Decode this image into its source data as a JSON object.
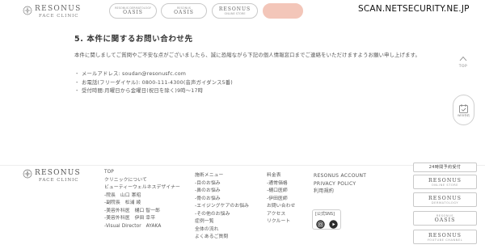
{
  "header": {
    "logo_main": "RESONUS",
    "logo_sub": "FACE CLINIC",
    "buttons": [
      {
        "title": "OASIS",
        "sub": "RESONUS DERMATOLOGY"
      },
      {
        "title": "OASIS",
        "sub": "RESONUS"
      },
      {
        "title": "RESONUS",
        "sub": "ONLINE STORE"
      },
      {
        "title": "",
        "sub": ""
      }
    ],
    "watermark": "SCAN.NETSECURITY.NE.JP"
  },
  "main": {
    "section_title": "5. 本件に関するお問い合わせ先",
    "body_text": "本件に関しましてご質問やご不安な点がございましたら、誠に恐縮ながら下記の個人情報窓口までご連絡をいただけますようお願い申し上げます。",
    "contact": [
      "メールアドレス: soudan@resonusfc.com",
      "お電話(フリーダイヤル): 0800-111-4300(音声ガイダンス5番)",
      "受付時間:月曜日から金曜日(祝日を除く)9時〜17時"
    ],
    "bullet": "・"
  },
  "side": {
    "to_top_label": "TOP",
    "reserve_label": "WEB予約"
  },
  "footer": {
    "logo_main": "RESONUS",
    "logo_sub": "FACE CLINIC",
    "col1": [
      "TOP",
      "クリニックについて",
      "ビューティーウェルネスデザイナー",
      "-院長　山口 憲昭",
      "-副院長　松浦 綾",
      "-美容外科医　樋口 智一郎",
      "-美容外科医　伊田 幸平",
      "-Visual Director　AYAKA"
    ],
    "col2": [
      "施術メニュー",
      "-目のお悩み",
      "-鼻のお悩み",
      "-骨のお悩み",
      "-エイジングケアのお悩み",
      "-その他のお悩み",
      "症例一覧",
      "全体の流れ",
      "よくあるご質問"
    ],
    "col3": [
      "料金表",
      "-通常価格",
      "-樋口医師",
      "-伊田医師",
      "お問い合わせ",
      "アクセス",
      "リクルート"
    ],
    "col4": [
      "RESONUS ACCOUNT",
      "PRIVACY POLICY",
      "利用規約"
    ],
    "sns_label": "[公式SNS]",
    "banners": [
      {
        "title": "24時間予約受付",
        "sub": ""
      },
      {
        "title": "RESONUS",
        "sub": "ONLINE STORE"
      },
      {
        "title": "RESONUS",
        "sub": "DERMATOLOGY"
      },
      {
        "title": "OASIS",
        "sub": "RESONUS"
      },
      {
        "title": "RESONUS",
        "sub": "YOUTUBE CHANNEL"
      }
    ]
  },
  "colors": {
    "accent": "#f3c6b9",
    "text": "#4a4a4a",
    "border": "#c9c9c9"
  }
}
